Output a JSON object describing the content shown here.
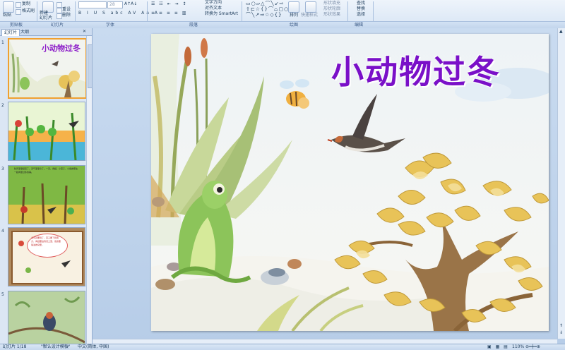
{
  "ribbon": {
    "clipboard": {
      "paste": "粘贴",
      "copy": "复制",
      "format_painter": "格式刷",
      "label": "剪贴板"
    },
    "slides": {
      "new_slide": "新建\n幻灯片",
      "reset": "重设",
      "delete": "删除",
      "label": "幻灯片"
    },
    "font": {
      "size": "28",
      "label": "字体"
    },
    "paragraph": {
      "text_direction": "文字方向",
      "align_text": "对齐文本",
      "smartart": "转换为 SmartArt",
      "label": "段落"
    },
    "drawing": {
      "arrange": "排列",
      "quick_styles": "快速样式",
      "shape_fill": "形状填充",
      "shape_outline": "形状轮廓",
      "shape_effects": "形状效果",
      "label": "绘图"
    },
    "editing": {
      "find": "查找",
      "replace": "替换",
      "select": "选择",
      "label": "编辑"
    }
  },
  "panel": {
    "tab_slides": "幻灯片",
    "tab_outline": "大纲"
  },
  "thumbnails": [
    {
      "number": "1",
      "title": "小动物过冬"
    },
    {
      "number": "2"
    },
    {
      "number": "3",
      "text": "秋风渐渐起来了，天气渐渐冷了。一天，青蛙、小燕子、小蜜蜂聚在一起商量过冬的事。"
    },
    {
      "number": "4",
      "text": "冬天就要到了，燕子要飞到南方，青蛙要钻到泥土里，蜜蜂要躲进蜂窝里。"
    },
    {
      "number": "5"
    }
  ],
  "slide": {
    "title": "小动物过冬"
  },
  "status": {
    "slide_info": "幻灯片 1/18",
    "theme": "\"默认设计模板\"",
    "language": "中文(简体, 中国)",
    "zoom": "110%"
  },
  "colors": {
    "title": "#7a10c8",
    "selection": "#f0a030",
    "ribbon_bg": "#dde8f5"
  }
}
